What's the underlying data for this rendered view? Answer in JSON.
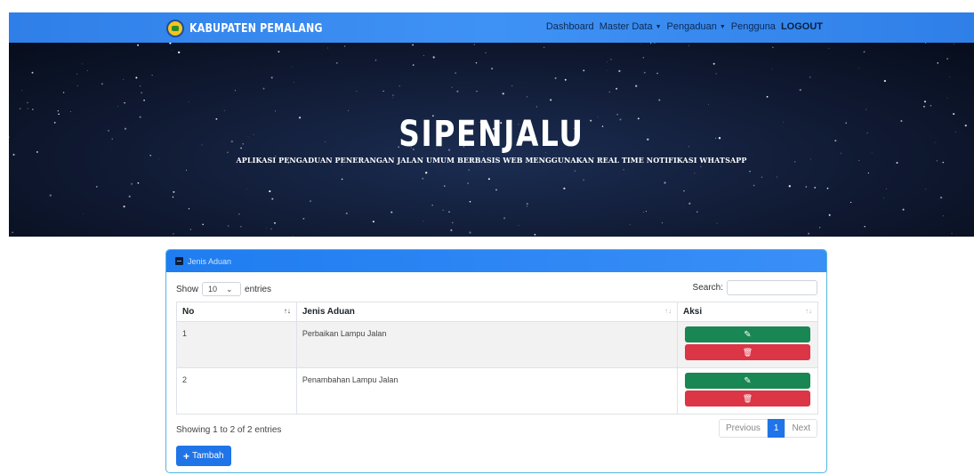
{
  "navbar": {
    "brand": "KABUPATEN PEMALANG",
    "links": {
      "dashboard": "Dashboard",
      "master_data": "Master Data",
      "pengaduan": "Pengaduan",
      "pengguna": "Pengguna",
      "logout": "LOGOUT"
    },
    "caret": "▼"
  },
  "hero": {
    "title": "SIPENJALU",
    "subtitle": "APLIKASI PENGADUAN PENERANGAN JALAN UMUM BERBASIS WEB MENGGUNAKAN REAL TIME NOTIFIKASI WHATSAPP"
  },
  "card": {
    "title": "Jenis Aduan",
    "show_label": "Show",
    "entries_value": "10",
    "entries_label": "entries",
    "search_label": "Search:",
    "search_value": "",
    "columns": [
      "No",
      "Jenis Aduan",
      "Aksi"
    ],
    "sort_glyph": "↑↓",
    "rows": [
      {
        "no": "1",
        "jenis": "Perbaikan Lampu Jalan"
      },
      {
        "no": "2",
        "jenis": "Penambahan Lampu Jalan"
      }
    ],
    "edit_icon": "✎",
    "delete_icon": "🗑",
    "info": "Showing 1 to 2 of 2 entries",
    "pagination": {
      "previous": "Previous",
      "current": "1",
      "next": "Next"
    },
    "add_button": "Tambah"
  },
  "colors": {
    "nav": "#3a8bf2",
    "hero": "#101a33",
    "edit": "#198754",
    "delete": "#dc3545",
    "primary": "#1f74e8"
  }
}
